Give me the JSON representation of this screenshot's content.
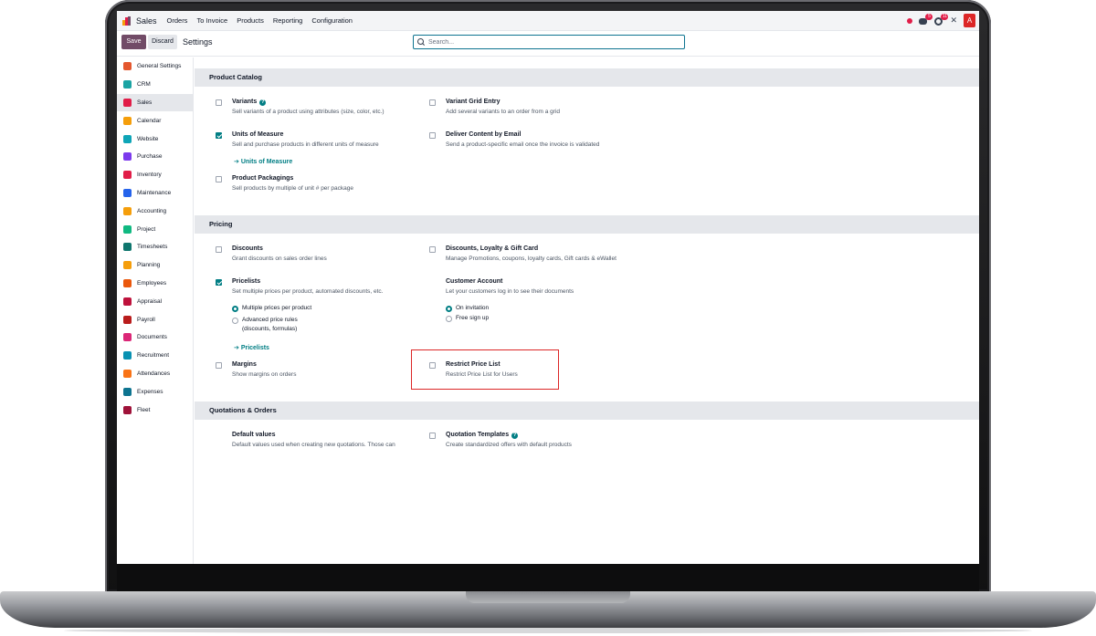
{
  "navbar": {
    "app_name": "Sales",
    "menu": [
      "Orders",
      "To Invoice",
      "Products",
      "Reporting",
      "Configuration"
    ],
    "messages_count": "5",
    "activities_count": "11",
    "user_initial": "A"
  },
  "control_panel": {
    "save_label": "Save",
    "discard_label": "Discard",
    "title": "Settings",
    "search_placeholder": "Search..."
  },
  "sidebar": {
    "items": [
      {
        "label": "General Settings",
        "icon": "general-settings-icon",
        "color": "#e4572e"
      },
      {
        "label": "CRM",
        "icon": "crm-icon",
        "color": "#1aa3a3"
      },
      {
        "label": "Sales",
        "icon": "sales-icon",
        "color": "#e11d48"
      },
      {
        "label": "Calendar",
        "icon": "calendar-icon",
        "color": "#f59e0b"
      },
      {
        "label": "Website",
        "icon": "website-icon",
        "color": "#0ea5b7"
      },
      {
        "label": "Purchase",
        "icon": "purchase-icon",
        "color": "#7c3aed"
      },
      {
        "label": "Inventory",
        "icon": "inventory-icon",
        "color": "#e11d48"
      },
      {
        "label": "Maintenance",
        "icon": "maintenance-icon",
        "color": "#2563eb"
      },
      {
        "label": "Accounting",
        "icon": "accounting-icon",
        "color": "#f59e0b"
      },
      {
        "label": "Project",
        "icon": "project-icon",
        "color": "#10b981"
      },
      {
        "label": "Timesheets",
        "icon": "timesheets-icon",
        "color": "#0f766e"
      },
      {
        "label": "Planning",
        "icon": "planning-icon",
        "color": "#f59e0b"
      },
      {
        "label": "Employees",
        "icon": "employees-icon",
        "color": "#ea580c"
      },
      {
        "label": "Appraisal",
        "icon": "appraisal-icon",
        "color": "#be123c"
      },
      {
        "label": "Payroll",
        "icon": "payroll-icon",
        "color": "#b91c1c"
      },
      {
        "label": "Documents",
        "icon": "documents-icon",
        "color": "#db2777"
      },
      {
        "label": "Recruitment",
        "icon": "recruitment-icon",
        "color": "#0891b2"
      },
      {
        "label": "Attendances",
        "icon": "attendances-icon",
        "color": "#f97316"
      },
      {
        "label": "Expenses",
        "icon": "expenses-icon",
        "color": "#0e7490"
      },
      {
        "label": "Fleet",
        "icon": "fleet-icon",
        "color": "#9f1239"
      }
    ]
  },
  "sections": {
    "product_catalog": {
      "title": "Product Catalog",
      "variants": {
        "title": "Variants",
        "desc": "Sell variants of a product using attributes (size, color, etc.)",
        "checked": false
      },
      "variant_grid": {
        "title": "Variant Grid Entry",
        "desc": "Add several variants to an order from a grid",
        "checked": false
      },
      "uom": {
        "title": "Units of Measure",
        "desc": "Sell and purchase products in different units of measure",
        "link": "Units of Measure",
        "checked": true
      },
      "deliver_email": {
        "title": "Deliver Content by Email",
        "desc": "Send a product-specific email once the invoice is validated",
        "checked": false
      },
      "packagings": {
        "title": "Product Packagings",
        "desc": "Sell products by multiple of unit # per package",
        "checked": false
      }
    },
    "pricing": {
      "title": "Pricing",
      "discounts": {
        "title": "Discounts",
        "desc": "Grant discounts on sales order lines",
        "checked": false
      },
      "loyalty": {
        "title": "Discounts, Loyalty & Gift Card",
        "desc": "Manage Promotions, coupons, loyalty cards, Gift cards & eWallet",
        "checked": false
      },
      "pricelists": {
        "title": "Pricelists",
        "desc": "Set multiple prices per product, automated discounts, etc.",
        "option_multiple": "Multiple prices per product",
        "option_advanced": "Advanced price rules",
        "option_advanced_sub": "(discounts, formulas)",
        "selected": "Multiple prices per product",
        "link": "Pricelists",
        "checked": true
      },
      "customer_account": {
        "title": "Customer Account",
        "desc": "Let your customers log in to see their documents",
        "option_invitation": "On invitation",
        "option_signup": "Free sign up",
        "selected": "On invitation"
      },
      "margins": {
        "title": "Margins",
        "desc": "Show margins on orders",
        "checked": false
      },
      "restrict_pricelist": {
        "title": "Restrict Price List",
        "desc": "Restrict Price List for Users",
        "checked": false
      }
    },
    "quotations": {
      "title": "Quotations & Orders",
      "default_values": {
        "title": "Default values",
        "desc": "Default values used when creating new quotations. Those can"
      },
      "templates": {
        "title": "Quotation Templates",
        "desc": "Create standardized offers with default products",
        "checked": false
      }
    }
  },
  "colors": {
    "brand": "#714b67",
    "accent": "#017e84",
    "highlight": "#dc2626"
  }
}
